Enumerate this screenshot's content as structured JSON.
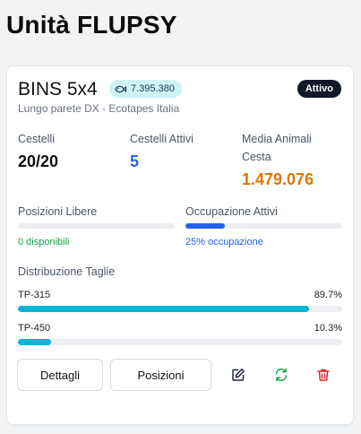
{
  "page": {
    "title": "Unità FLUPSY"
  },
  "card": {
    "name": "BINS 5x4",
    "animal_count": "7.395.380",
    "status": "Attivo",
    "location": "Lungo parete DX - Ecotapes Italia",
    "stats": [
      {
        "label": "Cestelli",
        "value": "20/20"
      },
      {
        "label": "Cestelli Attivi",
        "value": "5"
      },
      {
        "label": "Media Animali Cesta",
        "value": "1.479.076"
      }
    ],
    "occupancy": {
      "free": {
        "label": "Posizioni Libere",
        "note": "0 disponibili",
        "fraction": 0
      },
      "active": {
        "label": "Occupazione Attivi",
        "note": "25% occupazione",
        "fraction": 0.25
      }
    },
    "distribution": {
      "title": "Distribuzione Taglie",
      "sizes": [
        {
          "name": "TP-315",
          "percent_label": "89.7%",
          "fraction": 0.897
        },
        {
          "name": "TP-450",
          "percent_label": "10.3%",
          "fraction": 0.103
        }
      ]
    },
    "actions": {
      "details_label": "Dettagli",
      "positions_label": "Posizioni",
      "icons": [
        "edit-icon",
        "refresh-icon",
        "trash-icon"
      ]
    }
  },
  "colors": {
    "accent_blue": "#2563eb",
    "accent_orange": "#d97706",
    "accent_cyan": "#06b6d4",
    "success_green": "#16a34a",
    "danger_red": "#dc2626",
    "badge_dark": "#111827"
  }
}
